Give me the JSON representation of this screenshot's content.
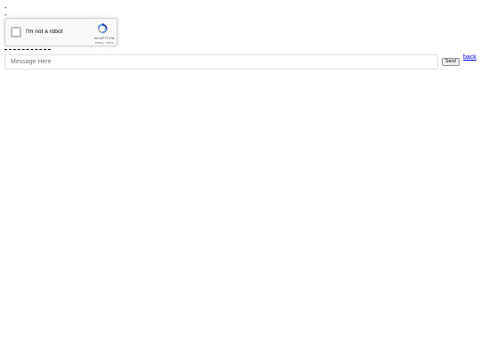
{
  "markers": {
    "line1": "-",
    "line2": "-"
  },
  "recaptcha": {
    "label": "I'm not a robot",
    "brand": "reCAPTCHA",
    "links": "Privacy - Terms",
    "checked": false
  },
  "chat": {
    "placeholder": "Message Here",
    "value": "",
    "send_label": "Send",
    "back_label": "back"
  },
  "colors": {
    "link": "#0000ee",
    "recaptcha_bg": "#f9f9f9",
    "recaptcha_blue": "#4a90e2"
  }
}
